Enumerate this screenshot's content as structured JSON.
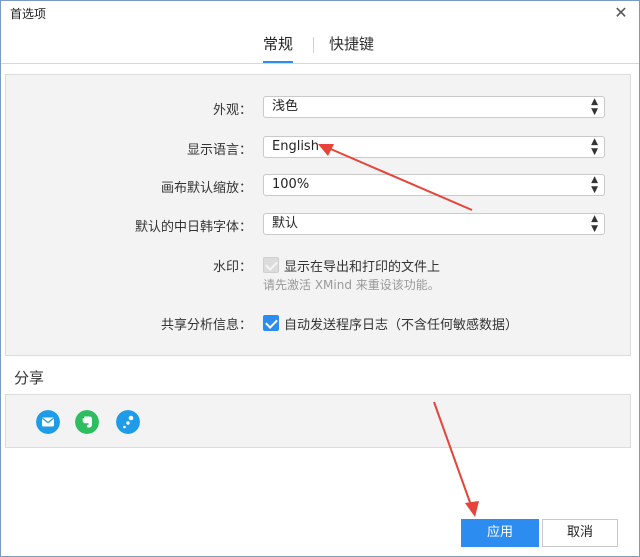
{
  "window": {
    "title": "首选项"
  },
  "tabs": [
    {
      "label": "常规",
      "active": true
    },
    {
      "label": "快捷键",
      "active": false
    }
  ],
  "settings": {
    "appearance": {
      "label": "外观：",
      "value": "浅色"
    },
    "language": {
      "label": "显示语言：",
      "value": "English"
    },
    "zoom": {
      "label": "画布默认缩放：",
      "value": "100%"
    },
    "cjk_font": {
      "label": "默认的中日韩字体：",
      "value": "默认"
    },
    "watermark": {
      "label": "水印：",
      "checkbox_label": "显示在导出和打印的文件上",
      "checked": true,
      "disabled": true,
      "hint": "请先激活 XMind 来重设该功能。"
    },
    "analytics": {
      "label": "共享分析信息：",
      "checkbox_label": "自动发送程序日志（不含任何敏感数据）",
      "checked": true
    }
  },
  "share": {
    "title": "分享",
    "icons": [
      {
        "name": "mail-icon",
        "color": "#1e9be9"
      },
      {
        "name": "evernote-icon",
        "color": "#2dbe60"
      },
      {
        "name": "share-dots-icon",
        "color": "#1e9be9"
      }
    ]
  },
  "footer": {
    "apply_label": "应用",
    "cancel_label": "取消"
  },
  "colors": {
    "accent": "#2d8cf0",
    "annotation_arrow": "#e8433a"
  }
}
